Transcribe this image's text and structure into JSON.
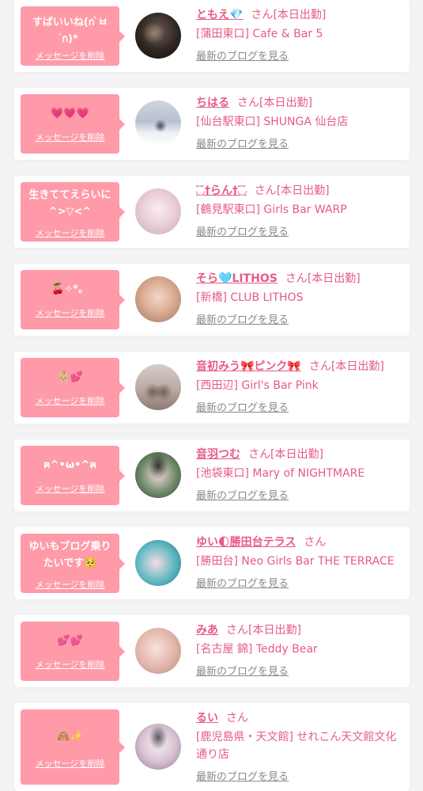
{
  "colors": {
    "bubble": "#ff9aa9",
    "accent": "#e75a85",
    "link_gray": "#8a8a8a",
    "card": "#ffffff",
    "background": "#f3f3f3"
  },
  "items": [
    {
      "message": "すばいいね(ก ̀ㅂ ́ก)*",
      "delete_label": "メッセージを削除",
      "name": "ともえ💎",
      "honorific": "さん",
      "status": "[本日出勤]",
      "shop": "[蒲田東口] Cafe & Bar 5",
      "blog_label": "最新のブログを見る",
      "avatar_icon": "cast-avatar-dark"
    },
    {
      "message": "💗💗💗",
      "delete_label": "メッセージを削除",
      "name": "ちはる",
      "honorific": "さん",
      "status": "[本日出勤]",
      "shop": "[仙台駅東口] SHUNGA 仙台店",
      "blog_label": "最新のブログを見る",
      "avatar_icon": "cast-avatar-snow"
    },
    {
      "message": "生きててえらいに ^>▽<^",
      "delete_label": "メッセージを削除",
      "name": "◟̆◞̆†らん†◟̆◞̆",
      "honorific": "さん",
      "status": "[本日出勤]",
      "shop": "[鶴見駅東口] Girls Bar WARP",
      "blog_label": "最新のブログを見る",
      "avatar_icon": "cast-avatar-light"
    },
    {
      "message": "🍒✧*。",
      "delete_label": "メッセージを削除",
      "name": "そら🩵LITHOS",
      "honorific": "さん",
      "status": "[本日出勤]",
      "shop": "[新橋] CLUB LITHOS",
      "blog_label": "最新のブログを見る",
      "avatar_icon": "cast-avatar-warm"
    },
    {
      "message": "👶🏼💕",
      "delete_label": "メッセージを削除",
      "name": "音初みう🎀ピンク🎀",
      "honorific": "さん",
      "status": "[本日出勤]",
      "shop": "[西田辺] Girl's Bar Pink",
      "blog_label": "最新のブログを見る",
      "avatar_icon": "cast-avatar-duo"
    },
    {
      "message": "ฅ^•ω•^ฅ",
      "delete_label": "メッセージを削除",
      "name": "音羽つむ",
      "honorific": "さん",
      "status": "[本日出勤]",
      "shop": "[池袋東口] Mary of NIGHTMARE",
      "blog_label": "最新のブログを見る",
      "avatar_icon": "cast-avatar-green"
    },
    {
      "message": "ゆいもブログ乗りたいです🥺",
      "delete_label": "メッセージを削除",
      "name": "ゆい🌓勝田台テラス",
      "honorific": "さん",
      "status": "",
      "shop": "[勝田台] Neo Girls Bar THE TERRACE",
      "blog_label": "最新のブログを見る",
      "avatar_icon": "cast-avatar-teal"
    },
    {
      "message": "💕💕",
      "delete_label": "メッセージを削除",
      "name": "みあ",
      "honorific": "さん",
      "status": "[本日出勤]",
      "shop": "[名古屋 錦] Teddy Bear",
      "blog_label": "最新のブログを見る",
      "avatar_icon": "cast-avatar-skin"
    },
    {
      "message": "🙈✨",
      "delete_label": "メッセージを削除",
      "name": "るい",
      "honorific": "さん",
      "status": "",
      "shop": "[鹿児島県・天文館] せれこん天文館文化通り店",
      "blog_label": "最新のブログを見る",
      "avatar_icon": "cast-avatar-pastel"
    }
  ]
}
